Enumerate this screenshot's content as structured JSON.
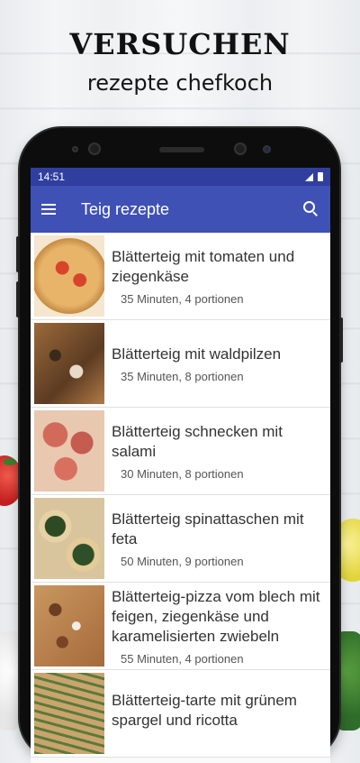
{
  "promo": {
    "title": "VERSUCHEN",
    "subtitle": "rezepte chefkoch"
  },
  "status_bar": {
    "time": "14:51"
  },
  "app_bar": {
    "title": "Teig rezepte",
    "menu_icon": "menu-icon",
    "search_icon": "search-icon"
  },
  "recipes": [
    {
      "title": "Blätterteig mit tomaten und ziegenkäse",
      "meta": "35 Minuten, 4 portionen"
    },
    {
      "title": "Blätterteig mit waldpilzen",
      "meta": "35 Minuten, 8 portionen"
    },
    {
      "title": "Blätterteig schnecken mit salami",
      "meta": "30 Minuten, 8 portionen"
    },
    {
      "title": "Blätterteig spinattaschen mit feta",
      "meta": "50 Minuten, 9 portionen"
    },
    {
      "title": "Blätterteig-pizza vom blech mit feigen, ziegenkäse und karamelisierten zwiebeln",
      "meta": "55 Minuten, 4 portionen"
    },
    {
      "title": "Blätterteig-tarte mit grünem spargel und ricotta",
      "meta": ""
    }
  ],
  "colors": {
    "app_bar": "#3f51b5",
    "status_bar": "#303f9f"
  }
}
